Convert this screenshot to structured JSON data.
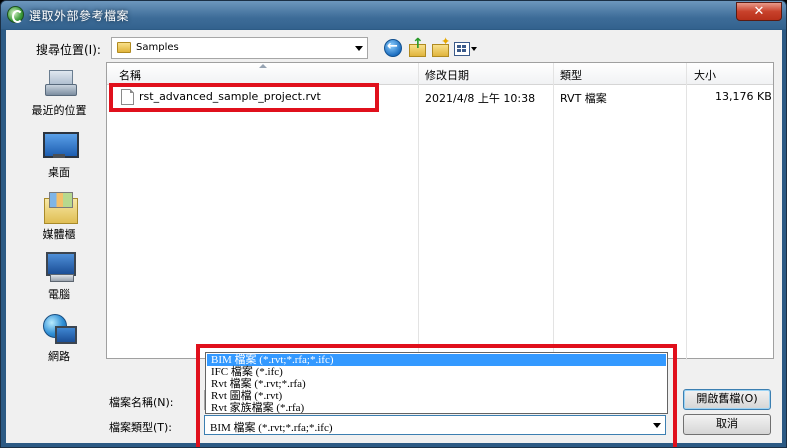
{
  "window": {
    "title": "選取外部參考檔案",
    "close_symbol": "✕"
  },
  "toolbar": {
    "lookin_label": "搜尋位置(I):",
    "lookin_value": "Samples"
  },
  "places": [
    {
      "label": "最近的位置",
      "icon": "recent-places-icon"
    },
    {
      "label": "桌面",
      "icon": "desktop-icon"
    },
    {
      "label": "媒體櫃",
      "icon": "libraries-icon"
    },
    {
      "label": "電腦",
      "icon": "computer-icon"
    },
    {
      "label": "網路",
      "icon": "network-icon"
    }
  ],
  "columns": {
    "name": "名稱",
    "modified": "修改日期",
    "type": "類型",
    "size": "大小"
  },
  "files": [
    {
      "name": "rst_advanced_sample_project.rvt",
      "modified": "2021/4/8 上午 10:38",
      "type": "RVT 檔案",
      "size": "13,176 KB"
    }
  ],
  "bottom": {
    "filename_label": "檔案名稱(N):",
    "filetype_label": "檔案類型(T):",
    "filetype_options": [
      "BIM 檔案 (*.rvt;*.rfa;*.ifc)",
      "IFC 檔案 (*.ifc)",
      "Rvt 檔案 (*.rvt;*.rfa)",
      "Rvt 圖檔 (*.rvt)",
      "Rvt 家族檔案 (*.rfa)"
    ],
    "filetype_selected": "BIM 檔案 (*.rvt;*.rfa;*.ifc)",
    "open_button": "開啟舊檔(O)",
    "cancel_button": "取消"
  },
  "colors": {
    "highlight": "#e0101c",
    "selection": "#3399ff"
  }
}
